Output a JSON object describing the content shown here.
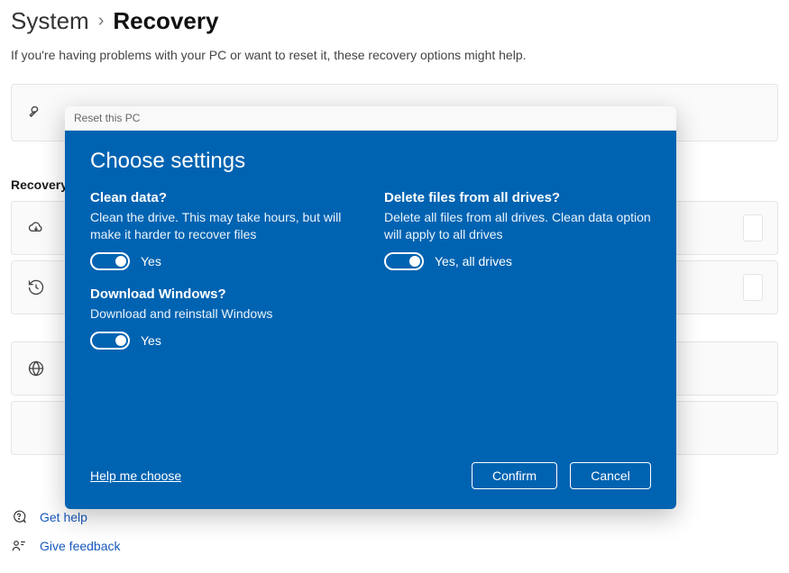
{
  "breadcrumb": {
    "parent": "System",
    "current": "Recovery"
  },
  "intro": "If you're having problems with your PC or want to reset it, these recovery options might help.",
  "recovery_section_label": "Recovery",
  "help_links": {
    "get_help": "Get help",
    "give_feedback": "Give feedback"
  },
  "modal": {
    "titlebar": "Reset this PC",
    "heading": "Choose settings",
    "settings": {
      "clean_data": {
        "question": "Clean data?",
        "description": "Clean the drive. This may take hours, but will make it harder to recover files",
        "value_label": "Yes"
      },
      "delete_all_drives": {
        "question": "Delete files from all drives?",
        "description": "Delete all files from all drives. Clean data option will apply to all drives",
        "value_label": "Yes, all drives"
      },
      "download_windows": {
        "question": "Download Windows?",
        "description": "Download and reinstall Windows",
        "value_label": "Yes"
      }
    },
    "help_link": "Help me choose",
    "confirm_label": "Confirm",
    "cancel_label": "Cancel"
  }
}
